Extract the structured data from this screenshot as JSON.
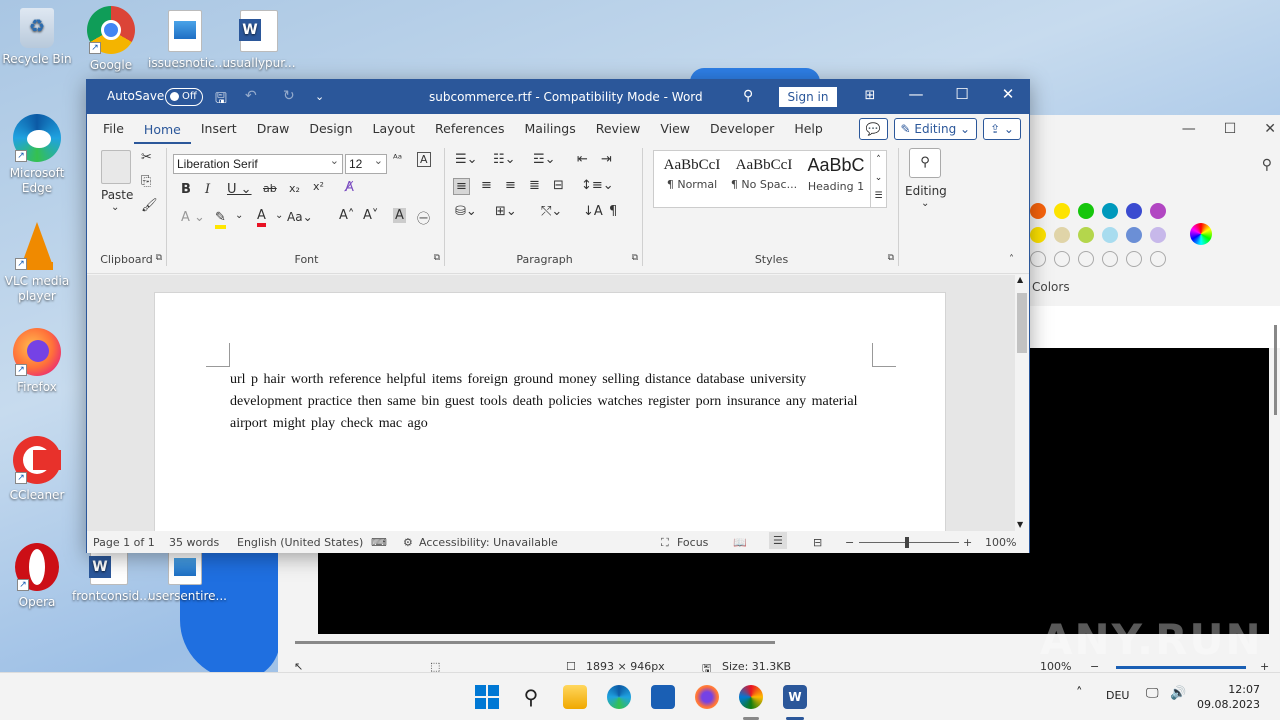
{
  "desktop": {
    "icons": [
      {
        "label": "Recycle Bin"
      },
      {
        "label": "Google Chrome"
      },
      {
        "label": "issuesnotic..."
      },
      {
        "label": "usuallypur..."
      },
      {
        "label": "Microsoft Edge"
      },
      {
        "label": "VLC media player"
      },
      {
        "label": "Firefox"
      },
      {
        "label": "CCleaner"
      },
      {
        "label": "Opera"
      },
      {
        "label": "frontconsid..."
      },
      {
        "label": "usersentire..."
      }
    ]
  },
  "paint": {
    "colors_label": "Colors",
    "status": {
      "dimensions": "1893 × 946px",
      "size": "Size: 31.3KB",
      "zoom": "100%"
    },
    "swatches": [
      "#f7630c",
      "#fde300",
      "#16c60c",
      "#0099bc",
      "#3b4bd0",
      "#b146c2",
      "#fce100",
      "#e0d4a8",
      "#b4d64c",
      "#a8dcef",
      "#6b8fd6",
      "#c7b8ea"
    ]
  },
  "word": {
    "titlebar": {
      "autosave_label": "AutoSave",
      "autosave_state": "Off",
      "title": "subcommerce.rtf  -  Compatibility Mode  -  Word",
      "signin": "Sign in"
    },
    "menu": [
      "File",
      "Home",
      "Insert",
      "Draw",
      "Design",
      "Layout",
      "References",
      "Mailings",
      "Review",
      "View",
      "Developer",
      "Help"
    ],
    "editing_label": "Editing",
    "ribbon": {
      "font_name": "Liberation Serif",
      "font_size": "12",
      "paste_label": "Paste",
      "groups": {
        "clipboard": "Clipboard",
        "font": "Font",
        "paragraph": "Paragraph",
        "styles": "Styles"
      },
      "styles": [
        {
          "sample": "AaBbCcI",
          "name": "¶ Normal"
        },
        {
          "sample": "AaBbCcI",
          "name": "¶ No Spac..."
        },
        {
          "sample": "AaBbC",
          "name": "Heading 1"
        }
      ],
      "editing_group_label": "Editing"
    },
    "document_text": "url p hair    worth reference helpful items foreign ground    money selling distance     database university     development          practice then same       bin guest tools death policies watches register porn insurance any material airport might play check mac ago",
    "status": {
      "page": "Page 1 of 1",
      "words": "35 words",
      "language": "English (United States)",
      "accessibility": "Accessibility: Unavailable",
      "focus": "Focus",
      "zoom": "100%"
    }
  },
  "taskbar": {
    "language": "DEU",
    "time": "12:07",
    "date": "09.08.2023"
  },
  "watermark": "ANY.RUN"
}
